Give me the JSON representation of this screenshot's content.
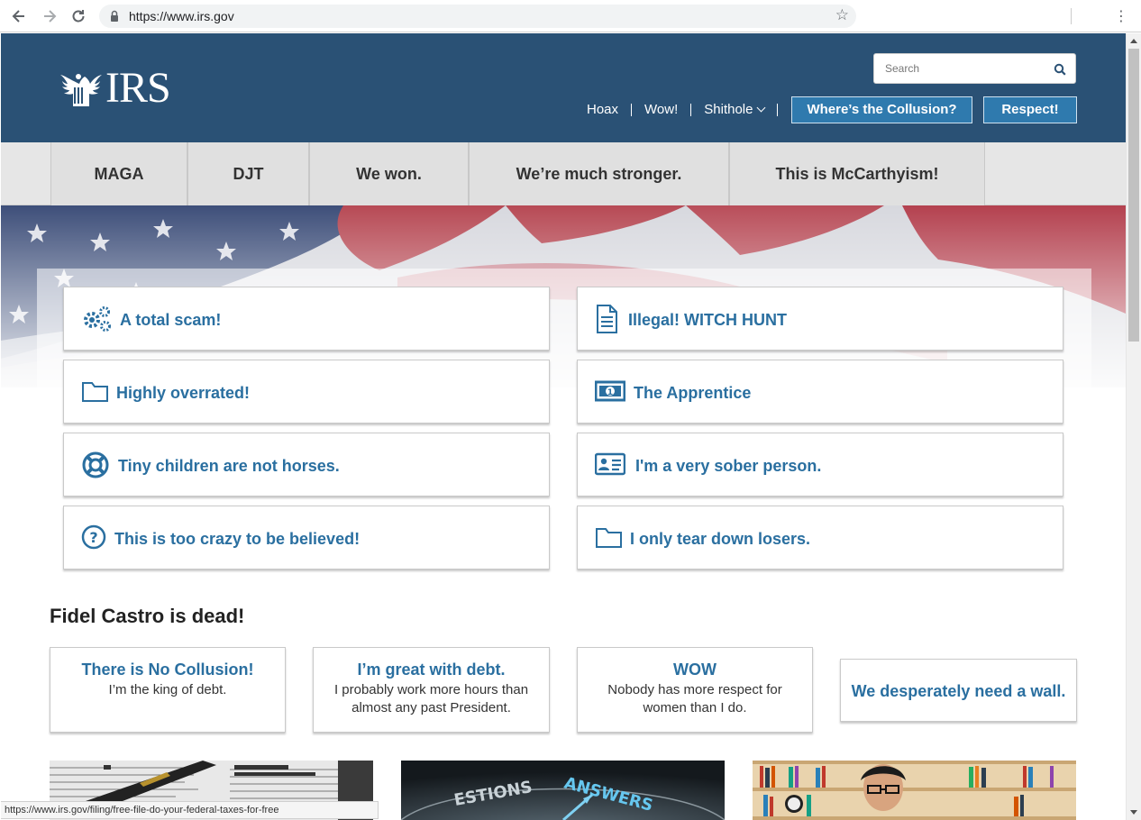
{
  "browser": {
    "url": "https://www.irs.gov",
    "back_icon": "back-arrow-icon",
    "forward_icon": "forward-arrow-icon",
    "reload_icon": "reload-icon",
    "status_url": "https://www.irs.gov/filing/free-file-do-your-federal-taxes-for-free"
  },
  "header": {
    "logo_text": "IRS",
    "search_placeholder": "Search",
    "links": [
      "Hoax",
      "Wow!",
      "Shithole"
    ],
    "buttons": [
      "Where’s the Collusion?",
      "Respect!"
    ],
    "colors": {
      "header_bg": "#2a5175",
      "button_bg": "#2f7aae",
      "link_blue": "#2a6fa0"
    }
  },
  "nav": {
    "tabs": [
      "MAGA",
      "DJT",
      "We won.",
      "We’re much stronger.",
      "This is McCarthyism!"
    ]
  },
  "tiles": [
    {
      "label": "A total scam!",
      "icon": "gears-icon"
    },
    {
      "label": "Illegal! WITCH HUNT",
      "icon": "document-icon"
    },
    {
      "label": "Highly overrated!",
      "icon": "folder-icon"
    },
    {
      "label": "The Apprentice",
      "icon": "money-icon"
    },
    {
      "label": "Tiny children are not horses.",
      "icon": "lifebuoy-icon"
    },
    {
      "label": "I'm a very sober person.",
      "icon": "id-card-icon"
    },
    {
      "label": "This is too crazy to be believed!",
      "icon": "question-circle-icon"
    },
    {
      "label": "I only tear down losers.",
      "icon": "folder-icon"
    }
  ],
  "section": {
    "heading": "Fidel Castro is dead!"
  },
  "cards": [
    {
      "title": "There is No Collusion!",
      "text": "I’m the king of debt."
    },
    {
      "title": "I’m great with debt.",
      "text": "I probably work more hours than almost any past President."
    },
    {
      "title": "WOW",
      "text": "Nobody has more respect for women than I do."
    },
    {
      "title": "We desperately need a wall.",
      "text": ""
    }
  ],
  "features": [
    {
      "image": "tax-form-photo"
    },
    {
      "image": "questions-answers-dial-photo"
    },
    {
      "image": "person-bookshelf-photo"
    }
  ]
}
